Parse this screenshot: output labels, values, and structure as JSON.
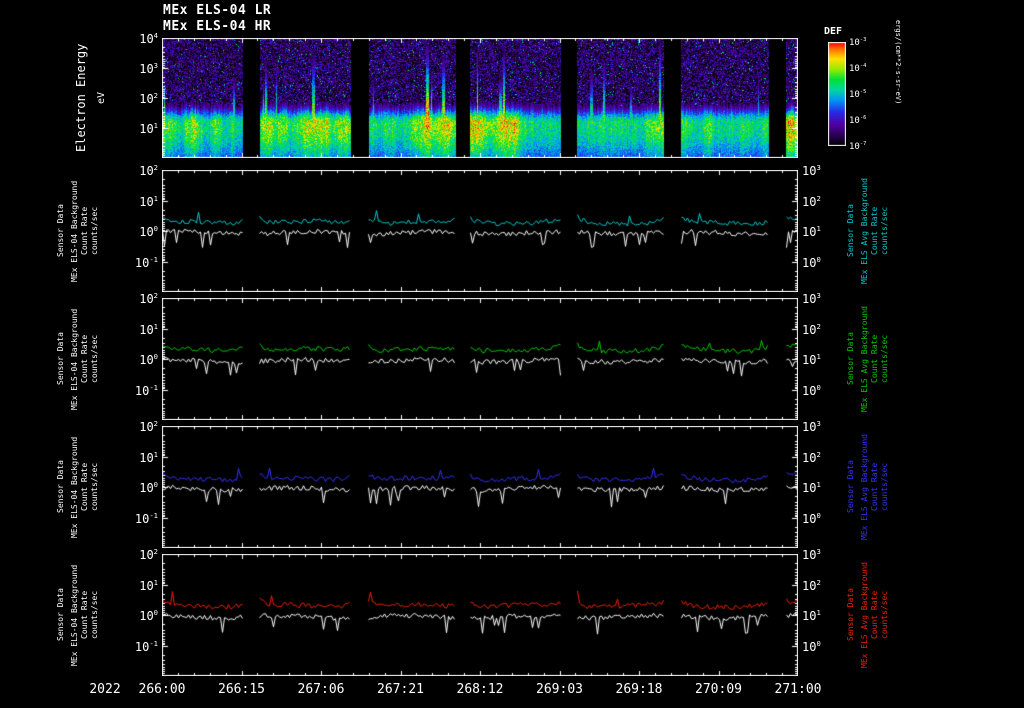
{
  "figure": {
    "background": "#000000",
    "titles": [
      "MEx ELS-04 LR",
      "MEx ELS-04 HR"
    ],
    "year_label": "2022",
    "x_tick_labels": [
      "266:00",
      "266:15",
      "267:06",
      "267:21",
      "268:12",
      "269:03",
      "269:18",
      "270:09",
      "271:00"
    ],
    "data_gap_segments": [
      [
        0,
        0.127
      ],
      [
        0.153,
        0.296
      ],
      [
        0.324,
        0.461
      ],
      [
        0.484,
        0.626
      ],
      [
        0.652,
        0.788
      ],
      [
        0.816,
        0.953
      ],
      [
        0.981,
        1.0
      ]
    ]
  },
  "chart_data": [
    {
      "type": "heatmap",
      "name": "electron-energy-spectrogram",
      "title": "MEx ELS-04 LR / MEx ELS-04 HR electron energy spectrogram",
      "ylabel": "Electron Energy",
      "y_units": "eV",
      "y_log_range": [
        0,
        4
      ],
      "y_tick_exponents": [
        4,
        3,
        2,
        1
      ],
      "x_range": [
        "266:00",
        "271:00"
      ],
      "band": {
        "center_log_ev": 1.15,
        "peak_level": 0.78,
        "description": "bright green-yellow flux band near 10-100 eV with vertical streaks reaching ~1 keV; dark blue/purple speckled background above; black vertical data gaps"
      },
      "colorbar": {
        "title": "DEF",
        "units": "ergs/(cm**2-s-sr-eV)",
        "tick_exponents": [
          -3,
          -4,
          -5,
          -6,
          -7
        ],
        "top_color": "#ff0000",
        "bottom_color": "#000000"
      }
    },
    {
      "type": "line",
      "name": "background-count-rate-panel-1",
      "left_label_lines": [
        "Sensor Data",
        "MEx ELS-04 Background",
        "Count Rate",
        "counts/sec"
      ],
      "right_label_lines": [
        "Sensor Data",
        "MEx ELS Avg Background",
        "Count Rate",
        "counts/sec"
      ],
      "left_tick_exponents": [
        2,
        1,
        0,
        -1
      ],
      "right_tick_exponents": [
        3,
        2,
        1,
        0
      ],
      "left_log_range": [
        -2,
        2
      ],
      "right_log_range": [
        -1,
        3
      ],
      "series": [
        {
          "name": "avg-background",
          "color": "#00cccc",
          "base_level_log10": 0.28
        },
        {
          "name": "background",
          "color": "#ffffff",
          "base_level_log10": -0.06
        }
      ],
      "seed": 101
    },
    {
      "type": "line",
      "name": "background-count-rate-panel-2",
      "left_label_lines": [
        "Sensor Data",
        "MEx ELS-04 Background",
        "Count Rate",
        "counts/sec"
      ],
      "right_label_lines": [
        "Sensor Data",
        "MEx ELS Avg Background",
        "Count Rate",
        "counts/sec"
      ],
      "left_tick_exponents": [
        2,
        1,
        0,
        -1
      ],
      "right_tick_exponents": [
        3,
        2,
        1,
        0
      ],
      "left_log_range": [
        -2,
        2
      ],
      "right_log_range": [
        -1,
        3
      ],
      "series": [
        {
          "name": "avg-background",
          "color": "#00cc00",
          "base_level_log10": 0.3
        },
        {
          "name": "background",
          "color": "#ffffff",
          "base_level_log10": -0.06
        }
      ],
      "seed": 202
    },
    {
      "type": "line",
      "name": "background-count-rate-panel-3",
      "left_label_lines": [
        "Sensor Data",
        "MEx ELS-04 Background",
        "Count Rate",
        "counts/sec"
      ],
      "right_label_lines": [
        "Sensor Data",
        "MEx ELS Avg Background",
        "Count Rate",
        "counts/sec"
      ],
      "left_tick_exponents": [
        2,
        1,
        0,
        -1
      ],
      "right_tick_exponents": [
        3,
        2,
        1,
        0
      ],
      "left_log_range": [
        -2,
        2
      ],
      "right_log_range": [
        -1,
        3
      ],
      "series": [
        {
          "name": "avg-background",
          "color": "#3333ff",
          "base_level_log10": 0.26
        },
        {
          "name": "background",
          "color": "#ffffff",
          "base_level_log10": -0.06
        }
      ],
      "seed": 303
    },
    {
      "type": "line",
      "name": "background-count-rate-panel-4",
      "left_label_lines": [
        "Sensor Data",
        "MEx ELS-04 Background",
        "Count Rate",
        "counts/sec"
      ],
      "right_label_lines": [
        "Sensor Data",
        "MEx ELS Avg Background",
        "Count Rate",
        "counts/sec"
      ],
      "left_tick_exponents": [
        2,
        1,
        0,
        -1
      ],
      "right_tick_exponents": [
        3,
        2,
        1,
        0
      ],
      "left_log_range": [
        -2,
        2
      ],
      "right_log_range": [
        -1,
        3
      ],
      "series": [
        {
          "name": "avg-background",
          "color": "#ee2200",
          "base_level_log10": 0.3
        },
        {
          "name": "background",
          "color": "#ffffff",
          "base_level_log10": -0.06
        }
      ],
      "seed": 404
    }
  ]
}
